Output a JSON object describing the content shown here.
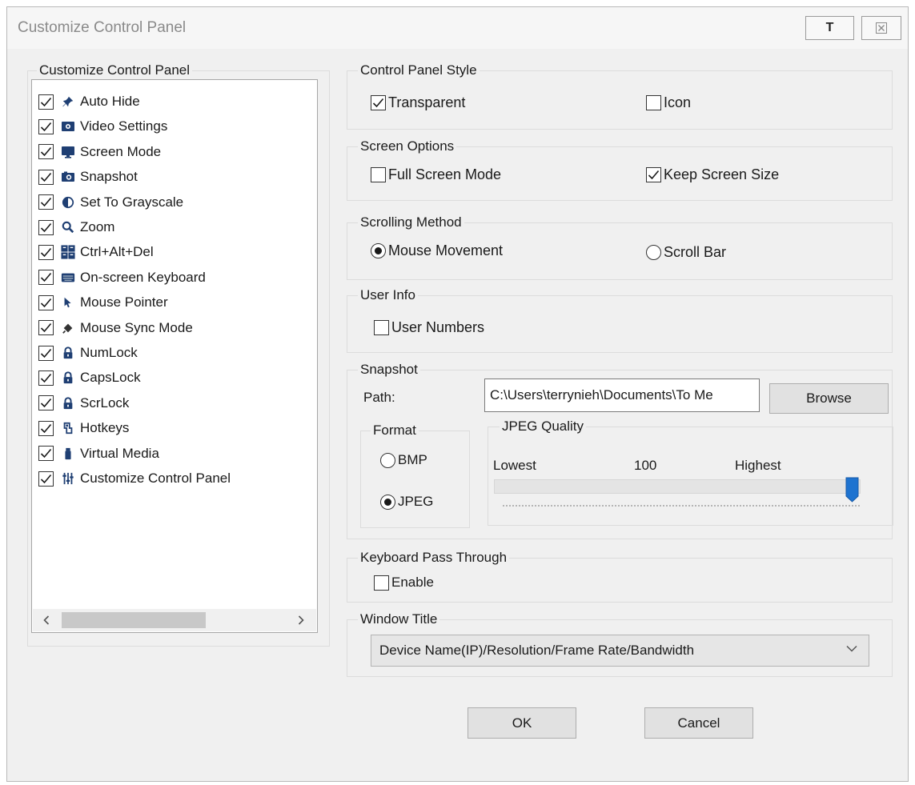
{
  "window": {
    "title": "Customize Control Panel",
    "t_button_label": "T",
    "close_icon": "close-icon"
  },
  "left_panel": {
    "group_label": "Customize Control Panel",
    "items": [
      {
        "label": "Auto Hide",
        "checked": true,
        "icon": "pin-icon"
      },
      {
        "label": "Video Settings",
        "checked": true,
        "icon": "video-settings-icon"
      },
      {
        "label": "Screen Mode",
        "checked": true,
        "icon": "monitor-icon"
      },
      {
        "label": "Snapshot",
        "checked": true,
        "icon": "camera-icon"
      },
      {
        "label": "Set To Grayscale",
        "checked": true,
        "icon": "contrast-icon"
      },
      {
        "label": "Zoom",
        "checked": true,
        "icon": "magnifier-icon"
      },
      {
        "label": "Ctrl+Alt+Del",
        "checked": true,
        "icon": "keys-icon"
      },
      {
        "label": "On-screen Keyboard",
        "checked": true,
        "icon": "keyboard-icon"
      },
      {
        "label": "Mouse Pointer",
        "checked": true,
        "icon": "pointer-icon"
      },
      {
        "label": "Mouse Sync Mode",
        "checked": true,
        "icon": "mouse-sync-icon"
      },
      {
        "label": "NumLock",
        "checked": true,
        "icon": "lock-icon"
      },
      {
        "label": "CapsLock",
        "checked": true,
        "icon": "lock-icon"
      },
      {
        "label": "ScrLock",
        "checked": true,
        "icon": "lock-icon"
      },
      {
        "label": "Hotkeys",
        "checked": true,
        "icon": "hotkeys-icon"
      },
      {
        "label": "Virtual Media",
        "checked": true,
        "icon": "usb-stick-icon"
      },
      {
        "label": "Customize Control Panel",
        "checked": true,
        "icon": "sliders-icon"
      }
    ]
  },
  "control_panel_style": {
    "group_label": "Control Panel Style",
    "transparent": {
      "label": "Transparent",
      "checked": true
    },
    "icon": {
      "label": "Icon",
      "checked": false
    }
  },
  "screen_options": {
    "group_label": "Screen Options",
    "full_screen": {
      "label": "Full Screen Mode",
      "checked": false
    },
    "keep_size": {
      "label": "Keep Screen Size",
      "checked": true
    }
  },
  "scrolling_method": {
    "group_label": "Scrolling Method",
    "mouse_movement": {
      "label": "Mouse Movement",
      "selected": true
    },
    "scroll_bar": {
      "label": "Scroll Bar",
      "selected": false
    }
  },
  "user_info": {
    "group_label": "User Info",
    "user_numbers": {
      "label": "User Numbers",
      "checked": false
    }
  },
  "snapshot": {
    "group_label": "Snapshot",
    "path_label": "Path:",
    "path_value": "C:\\Users\\terrynieh\\Documents\\To Me",
    "browse_label": "Browse",
    "format": {
      "group_label": "Format",
      "bmp": {
        "label": "BMP",
        "selected": false
      },
      "jpeg": {
        "label": "JPEG",
        "selected": true
      }
    },
    "jpeg_quality": {
      "group_label": "JPEG Quality",
      "lowest": "Lowest",
      "value": "100",
      "highest": "Highest",
      "level": 1.0
    }
  },
  "keyboard_pass_through": {
    "group_label": "Keyboard Pass Through",
    "enable": {
      "label": "Enable",
      "checked": false
    }
  },
  "window_title": {
    "group_label": "Window Title",
    "selected": "Device Name(IP)/Resolution/Frame Rate/Bandwidth"
  },
  "buttons": {
    "ok": "OK",
    "cancel": "Cancel"
  },
  "colors": {
    "dialog_bg": "#f0f0f0",
    "slider_thumb": "#1e73d0",
    "title_text": "#8a8a8a"
  }
}
